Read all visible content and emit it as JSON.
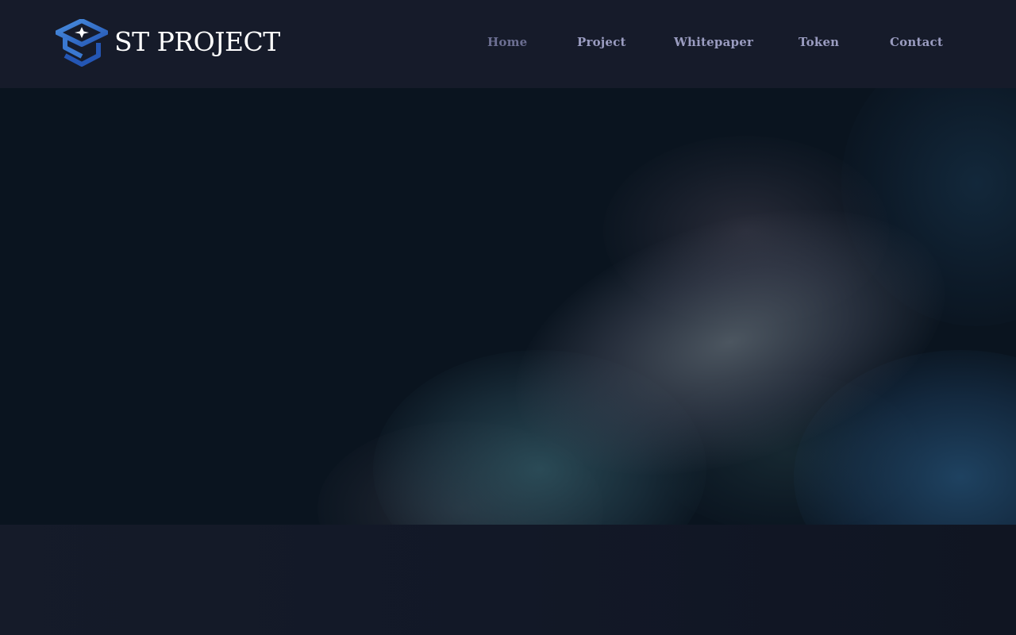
{
  "brand": {
    "name": "ST PROJECT",
    "logo_icon": "graduation-cap-s-logo",
    "logo_color": "#3b7bd4"
  },
  "nav": {
    "items": [
      {
        "label": "Home",
        "active": true
      },
      {
        "label": "Project",
        "active": false
      },
      {
        "label": "Whitepaper",
        "active": false
      },
      {
        "label": "Token",
        "active": false
      },
      {
        "label": "Contact",
        "active": false
      }
    ]
  },
  "colors": {
    "header_bg": "#161b2a",
    "nav_text": "#9a9cc0",
    "nav_active": "#6c6f92",
    "hero_bg": "#0a141f",
    "footer_bg": "#131927"
  }
}
